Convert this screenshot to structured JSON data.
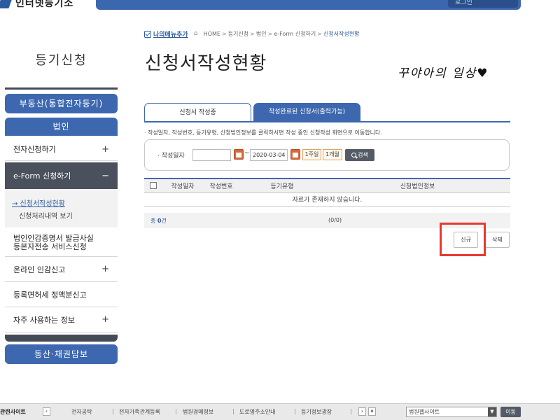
{
  "header": {
    "logo_text": "인터넷등기소",
    "utility_label": "로그인"
  },
  "breadcrumb": {
    "my_menu_label": "나의메뉴추가",
    "items": [
      "HOME",
      "등기신청",
      "법인",
      "e-Form 신청하기",
      "신청서작성현황"
    ],
    "separator": ">"
  },
  "page_title": "신청서작성현황",
  "watermark_text": "꾸야아의 일상♥",
  "sidebar": {
    "title": "등기신청",
    "top_buttons": [
      "부동산(통합전자등기)",
      "법인"
    ],
    "items": [
      {
        "label": "전자신청하기",
        "toggle": "+"
      },
      {
        "label": "e-Form 신청하기",
        "toggle": "−"
      },
      {
        "label_line1": "법인인감증명서 발급사실",
        "label_line2": "등본자전송 서비스신청"
      },
      {
        "label": "온라인 인감신고",
        "toggle": "+"
      },
      {
        "label": "등록면허세 정액분신고"
      },
      {
        "label": "자주 사용하는 정보",
        "toggle": "+"
      }
    ],
    "sub_items": [
      "→ 신청서작성현황",
      "신청처리내역 보기"
    ],
    "bottom_button": "동산·채권담보"
  },
  "tabs": [
    "신청서 작성중",
    "작성완료된 신청서(출력가능)"
  ],
  "notice": "· 작성일자, 작성번호, 등기유형, 신청법인정보를 클릭하시면 작성 중인 신청작성 화면으로 이동합니다.",
  "search": {
    "label": "· 작성일자",
    "date_from": "",
    "date_to": "2020-03-04",
    "tilde": "~",
    "period_1week": "1주일",
    "period_1month": "1개월",
    "search_button": "검색"
  },
  "table": {
    "headers": [
      "작성일자",
      "작성번호",
      "등기유형",
      "신청법인정보"
    ],
    "empty_message": "자료가 존재하지 않습니다."
  },
  "summary": {
    "total_prefix": "총",
    "total_count": "0",
    "total_suffix": "건",
    "paging": "(0/0)"
  },
  "actions": {
    "new_label": "신규",
    "delete_label": "삭제"
  },
  "footer": {
    "title": "관련사이트",
    "prev_arrow": "‹",
    "links": [
      "전자공탁",
      "전자가족관계등록",
      "법원경매정보",
      "도로명주소안내",
      "등기정보광장"
    ],
    "next_arrow": "›",
    "pause": "⏸",
    "select_value": "법원웹사이트",
    "go_button": "이동"
  },
  "colors": {
    "primary_blue": "#3d68b0",
    "dark_nav": "#4a505c",
    "highlight_red": "#e53a30",
    "calendar_orange": "#d86a3a"
  }
}
